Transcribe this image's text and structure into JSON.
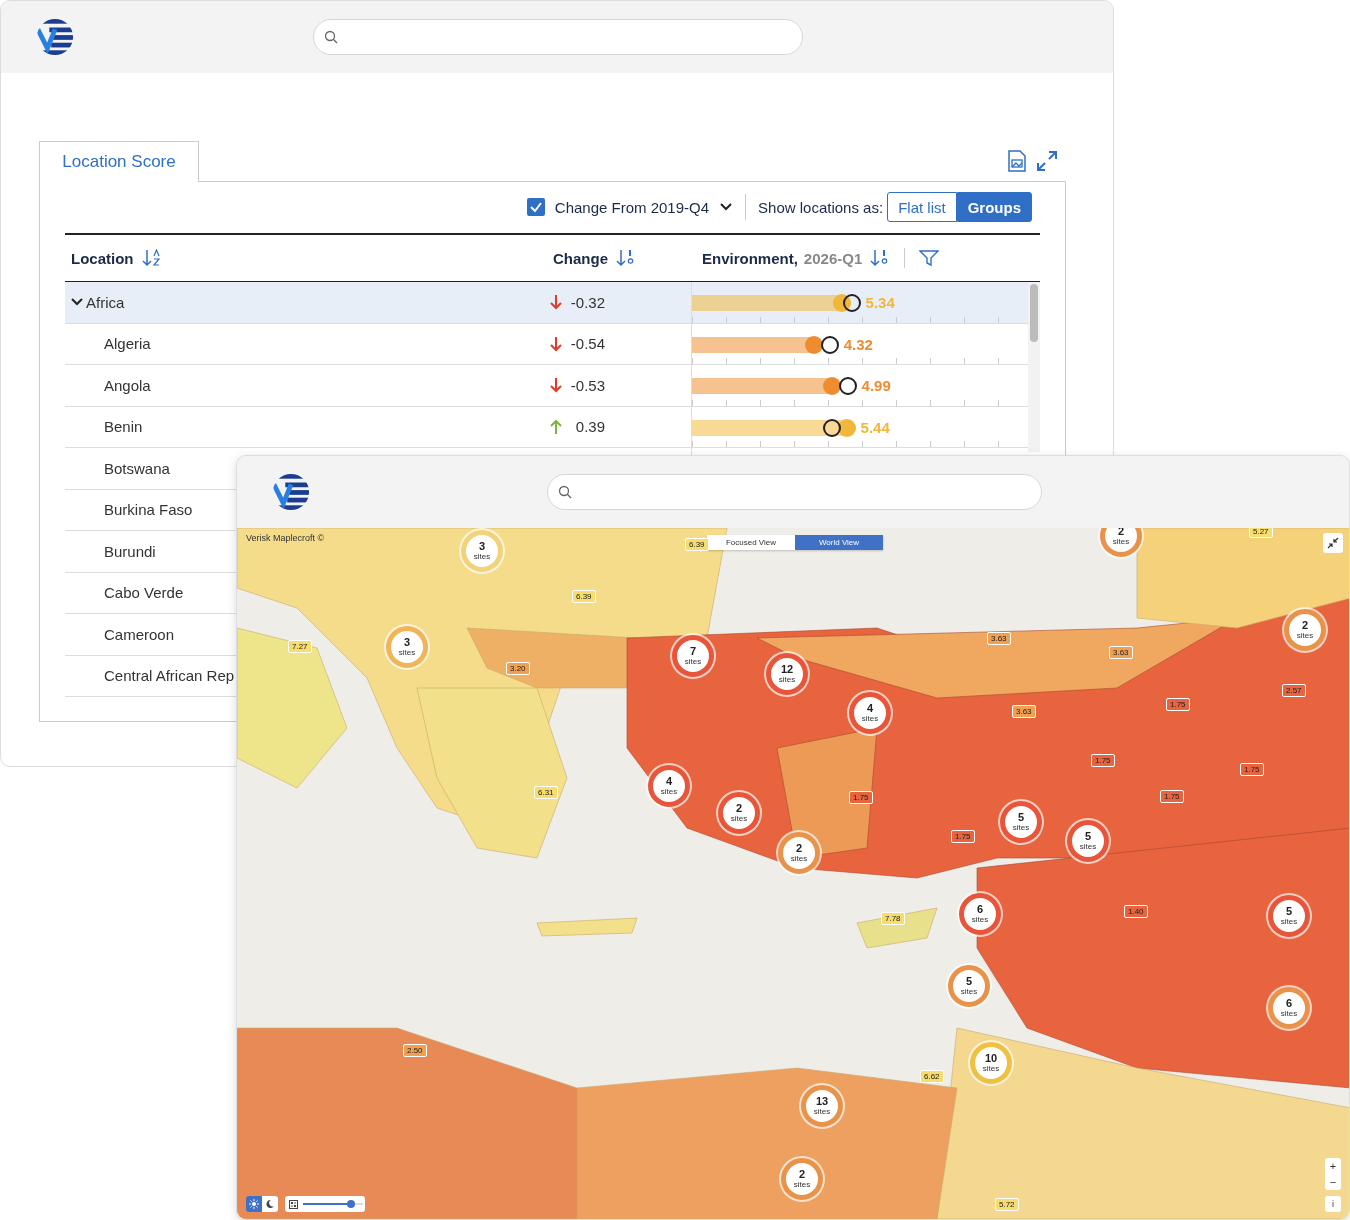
{
  "back_window": {
    "tabs": [
      {
        "label": "Location Score",
        "selected": true
      }
    ],
    "toolbar": {
      "change_from": {
        "label": "Change From 2019-Q4",
        "checked": true
      },
      "show_as_label": "Show locations as:",
      "view_options": [
        {
          "label": "Flat list",
          "selected": false
        },
        {
          "label": "Groups",
          "selected": true
        }
      ]
    },
    "table": {
      "columns": [
        {
          "label": "Location",
          "kind": "alpha"
        },
        {
          "label": "Change",
          "kind": "numeric"
        },
        {
          "label": "Environment,",
          "period": "2026-Q1",
          "kind": "numeric",
          "filter": true
        }
      ],
      "rows": [
        {
          "name": "Africa",
          "expanded": true,
          "selected": true,
          "change": "-0.32",
          "kind": "decrease",
          "score": "5.34",
          "color": "#f2b73a",
          "level": 0.445,
          "baseline": {
            "level": 0.475
          },
          "children": [
            {
              "name": "Algeria",
              "selected": false,
              "change": "-0.54",
              "kind": "decrease",
              "score": "4.32",
              "color": "#ef8c2e",
              "level": 0.362,
              "baseline": {
                "level": 0.41
              }
            },
            {
              "name": "Angola",
              "selected": false,
              "change": "-0.53",
              "kind": "decrease",
              "score": "4.99",
              "color": "#ef8c2e",
              "level": 0.418,
              "baseline": {
                "level": 0.463
              }
            },
            {
              "name": "Benin",
              "selected": false,
              "change": "0.39",
              "kind": "increase",
              "score": "5.44",
              "color": "#f2b73a",
              "level": 0.46,
              "baseline": {
                "level": 0.418
              }
            },
            {
              "name": "Botswana",
              "selected": false
            },
            {
              "name": "Burkina Faso",
              "selected": false
            },
            {
              "name": "Burundi",
              "selected": false
            },
            {
              "name": "Cabo Verde",
              "selected": false
            },
            {
              "name": "Cameroon",
              "selected": false
            },
            {
              "name": "Central African Rep",
              "selected": false
            }
          ]
        }
      ]
    }
  },
  "map_window": {
    "attribution": "Verisk Maplecroft ©",
    "view_toggle": [
      {
        "label": "Focused View",
        "selected": false
      },
      {
        "label": "World View",
        "selected": true
      }
    ],
    "clusters": [
      {
        "count": "3",
        "unit": "sites",
        "color": "#f2d27a"
      },
      {
        "count": "3",
        "unit": "sites",
        "color": "#f0b55a"
      },
      {
        "count": "7",
        "unit": "sites",
        "color": "#e8553a"
      },
      {
        "count": "12",
        "unit": "sites",
        "color": "#e8553a"
      },
      {
        "count": "4",
        "unit": "sites",
        "color": "#e8553a"
      },
      {
        "count": "4",
        "unit": "sites",
        "color": "#e8553a"
      },
      {
        "count": "2",
        "unit": "sites",
        "color": "#e8553a"
      },
      {
        "count": "2",
        "unit": "sites",
        "color": "#e8924a"
      },
      {
        "count": "5",
        "unit": "sites",
        "color": "#e8553a"
      },
      {
        "count": "5",
        "unit": "sites",
        "color": "#e8553a"
      },
      {
        "count": "6",
        "unit": "sites",
        "color": "#e8553a"
      },
      {
        "count": "5",
        "unit": "sites",
        "color": "#e8924a"
      },
      {
        "count": "10",
        "unit": "sites",
        "color": "#f0c040"
      },
      {
        "count": "13",
        "unit": "sites",
        "color": "#e8924a"
      },
      {
        "count": "2",
        "unit": "sites",
        "color": "#e8924a"
      },
      {
        "count": "2",
        "unit": "sites",
        "color": "#e8924a"
      },
      {
        "count": "2",
        "unit": "sites",
        "color": "#e8924a"
      },
      {
        "count": "5",
        "unit": "sites",
        "color": "#e8553a"
      },
      {
        "count": "6",
        "unit": "sites",
        "color": "#e8924a"
      }
    ],
    "score_badges": [
      {
        "value": "6.39",
        "color": "#f7dc6f"
      },
      {
        "value": "7.27",
        "color": "#f7dc6f"
      },
      {
        "value": "6.39",
        "color": "#f7dc6f"
      },
      {
        "value": "3.20",
        "color": "#f0a050"
      },
      {
        "value": "3.63",
        "color": "#f0a050"
      },
      {
        "value": "3.63",
        "color": "#f0a050"
      },
      {
        "value": "1.75",
        "color": "#e8643e"
      },
      {
        "value": "3.63",
        "color": "#f0a050"
      },
      {
        "value": "1.75",
        "color": "#e8643e"
      },
      {
        "value": "1.75",
        "color": "#e8643e"
      },
      {
        "value": "1.75",
        "color": "#e8643e"
      },
      {
        "value": "6.31",
        "color": "#f7dc6f"
      },
      {
        "value": "1.75",
        "color": "#e8643e"
      },
      {
        "value": "1.75",
        "color": "#e8643e"
      },
      {
        "value": "7.78",
        "color": "#f7dc6f"
      },
      {
        "value": "1.40",
        "color": "#e8643e"
      },
      {
        "value": "2.50",
        "color": "#f0a050"
      },
      {
        "value": "6.62",
        "color": "#f7dc6f"
      },
      {
        "value": "5.72",
        "color": "#f7dc6f"
      },
      {
        "value": "5.27",
        "color": "#f7dc6f"
      },
      {
        "value": "2.57",
        "color": "#e8643e"
      }
    ],
    "theme_toggle": [
      {
        "kind": "light",
        "selected": true
      },
      {
        "kind": "dark",
        "selected": false
      }
    ],
    "opacity_slider": {
      "level": 0.8
    },
    "zoom": [
      "+",
      "−"
    ],
    "info": "i"
  }
}
